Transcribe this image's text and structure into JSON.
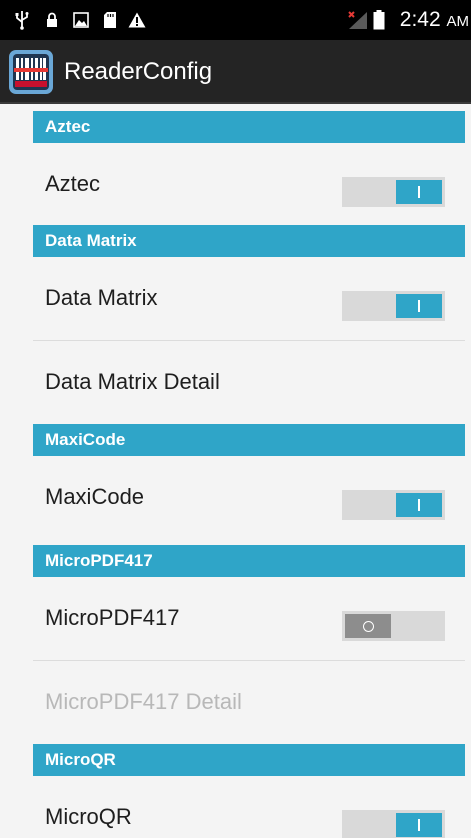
{
  "status_bar": {
    "icons": [
      "usb-icon",
      "lock-icon",
      "image-icon",
      "sd-card-icon",
      "warning-icon",
      "no-signal-icon",
      "battery-icon"
    ],
    "time": "2:42",
    "ampm": "AM"
  },
  "action_bar": {
    "title": "ReaderConfig",
    "icon": "barcode-app-icon"
  },
  "colors": {
    "accent": "#2fa5c8",
    "switch_track": "#d9d9d9",
    "switch_off_thumb": "#8d8d8d"
  },
  "sections": {
    "aztec": {
      "header": "Aztec",
      "toggle": {
        "label": "Aztec",
        "checked": true
      }
    },
    "data_matrix": {
      "header": "Data Matrix",
      "toggle": {
        "label": "Data Matrix",
        "checked": true
      },
      "detail": {
        "label": "Data Matrix Detail",
        "enabled": true
      }
    },
    "maxicode": {
      "header": "MaxiCode",
      "toggle": {
        "label": "MaxiCode",
        "checked": true
      }
    },
    "micropdf417": {
      "header": "MicroPDF417",
      "toggle": {
        "label": "MicroPDF417",
        "checked": false
      },
      "detail": {
        "label": "MicroPDF417 Detail",
        "enabled": false
      }
    },
    "microqr": {
      "header": "MicroQR",
      "toggle": {
        "label": "MicroQR",
        "checked": true
      }
    }
  }
}
